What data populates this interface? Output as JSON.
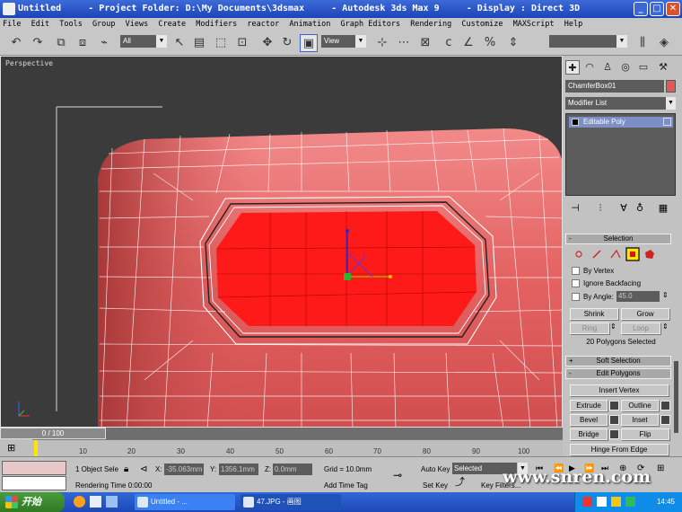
{
  "window": {
    "title": "Untitled     - Project Folder: D:\\My Documents\\3dsmax     - Autodesk 3ds Max 9     - Display : Direct 3D",
    "minimize": "_",
    "maximize": "□",
    "close": "✕"
  },
  "menu": [
    "File",
    "Edit",
    "Tools",
    "Group",
    "Views",
    "Create",
    "Modifiers",
    "reactor",
    "Animation",
    "Graph Editors",
    "Rendering",
    "Customize",
    "MAXScript",
    "Help"
  ],
  "toolbar": {
    "filter_value": "All",
    "refcoord_value": "View"
  },
  "viewport": {
    "label": "Perspective"
  },
  "command_panel": {
    "object_name": "ChamferBox01",
    "object_color": "#e05a5a",
    "modifier_list": "Modifier List",
    "stack_item": "Editable Poly",
    "selection": {
      "title": "Selection",
      "by_vertex": "By Vertex",
      "ignore_backfacing": "Ignore Backfacing",
      "by_angle": "By Angle:",
      "angle_value": "45.0",
      "shrink": "Shrink",
      "grow": "Grow",
      "ring": "Ring",
      "loop": "Loop",
      "status": "20 Polygons Selected"
    },
    "soft_selection": {
      "title": "Soft Selection"
    },
    "edit_polygons": {
      "title": "Edit Polygons",
      "insert_vertex": "Insert Vertex",
      "extrude": "Extrude",
      "outline": "Outline",
      "bevel": "Bevel",
      "inset": "Inset",
      "bridge": "Bridge",
      "flip": "Flip",
      "hinge": "Hinge From Edge"
    }
  },
  "timeline": {
    "time": "0 / 100",
    "ticks": [
      "10",
      "20",
      "30",
      "40",
      "50",
      "60",
      "70",
      "80",
      "90",
      "100"
    ]
  },
  "status": {
    "selection_count": "1 Object Sele",
    "rendering_time": "Rendering Time  0:00:00",
    "x_label": "X:",
    "x_value": "-35.063mm",
    "y_label": "Y:",
    "y_value": "1356.1mm",
    "z_label": "Z:",
    "z_value": "0.0mm",
    "grid": "Grid = 10.0mm",
    "add_time_tag": "Add Time Tag",
    "auto_key": "Auto Key",
    "set_key": "Set Key",
    "key_filters": "Key Filters...",
    "key_mode": "Selected"
  },
  "taskbar": {
    "start": "开始",
    "tasks": [
      "Untitled     - ...",
      "47.JPG - 画图"
    ],
    "clock": "14:45"
  },
  "watermark": "www.snren.com"
}
